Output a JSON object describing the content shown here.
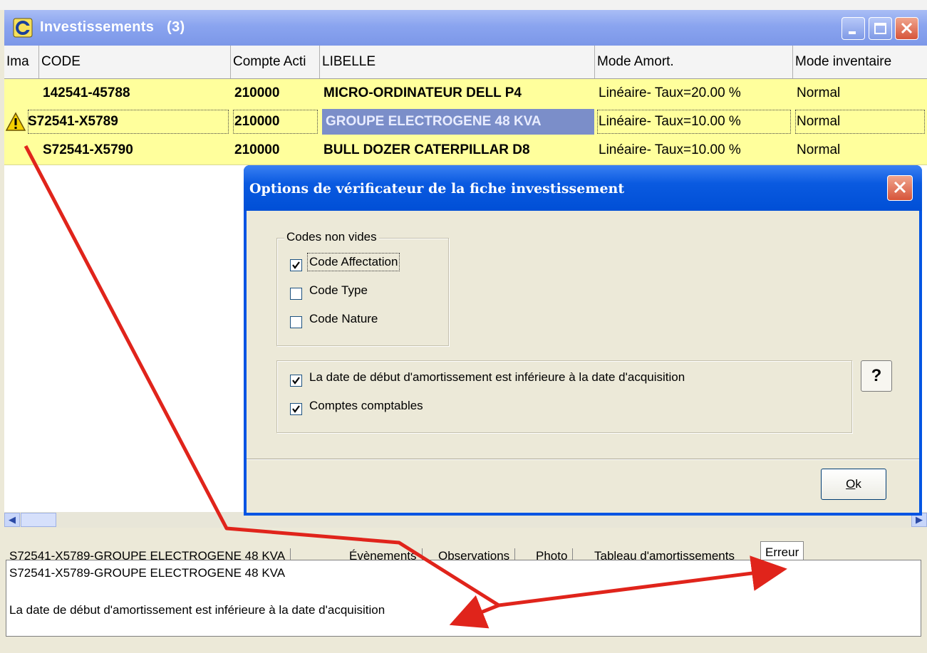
{
  "window": {
    "title": "Investissements",
    "count": "(3)"
  },
  "grid": {
    "columns": [
      "Ima",
      "CODE",
      "Compte Acti",
      "LIBELLE",
      "Mode Amort.",
      "Mode inventaire"
    ],
    "rows": [
      {
        "code": "142541-45788",
        "compte": "210000",
        "libelle": "MICRO-ORDINATEUR DELL P4",
        "mode_amort": "Linéaire- Taux=20.00 %",
        "mode_inventaire": "Normal",
        "warning": false
      },
      {
        "code": "S72541-X5789",
        "compte": "210000",
        "libelle": "GROUPE ELECTROGENE 48 KVA",
        "mode_amort": "Linéaire- Taux=10.00 %",
        "mode_inventaire": "Normal",
        "warning": true
      },
      {
        "code": "S72541-X5790",
        "compte": "210000",
        "libelle": "BULL DOZER CATERPILLAR D8",
        "mode_amort": "Linéaire- Taux=10.00 %",
        "mode_inventaire": "Normal",
        "warning": false
      }
    ]
  },
  "dialog": {
    "title": "Options de vérificateur de la fiche investissement",
    "group_label": "Codes non vides",
    "options": [
      {
        "label": "Code Affectation",
        "checked": true
      },
      {
        "label": "Code Type",
        "checked": false
      },
      {
        "label": "Code Nature",
        "checked": false
      }
    ],
    "options2": [
      {
        "label": "La date de début d'amortissement est inférieure à la date d'acquisition",
        "checked": true
      },
      {
        "label": "Comptes comptables",
        "checked": true
      }
    ],
    "help_label": "?",
    "ok_label": "Ok"
  },
  "tabs": [
    {
      "label": "S72541-X5789-GROUPE ELECTROGENE 48 KVA"
    },
    {
      "label": "Évènements"
    },
    {
      "label": "Observations"
    },
    {
      "label": "Photo"
    },
    {
      "label": "Tableau d'amortissements"
    },
    {
      "label": "Erreur",
      "active": true
    }
  ],
  "error_panel": {
    "line1": "S72541-X5789-GROUPE ELECTROGENE 48 KVA",
    "line2": "La date de début d'amortissement est inférieure à la date d'acquisition"
  },
  "colors": {
    "row_highlight": "#ffff9c",
    "selected_cell": "#7b8ec9",
    "annotation_arrow": "#e0241b"
  },
  "icons": [
    "app-icon",
    "minimize-icon",
    "maximize-icon",
    "close-icon",
    "warning-icon",
    "scroll-left-icon",
    "scroll-right-icon",
    "checkbox-check-icon"
  ]
}
